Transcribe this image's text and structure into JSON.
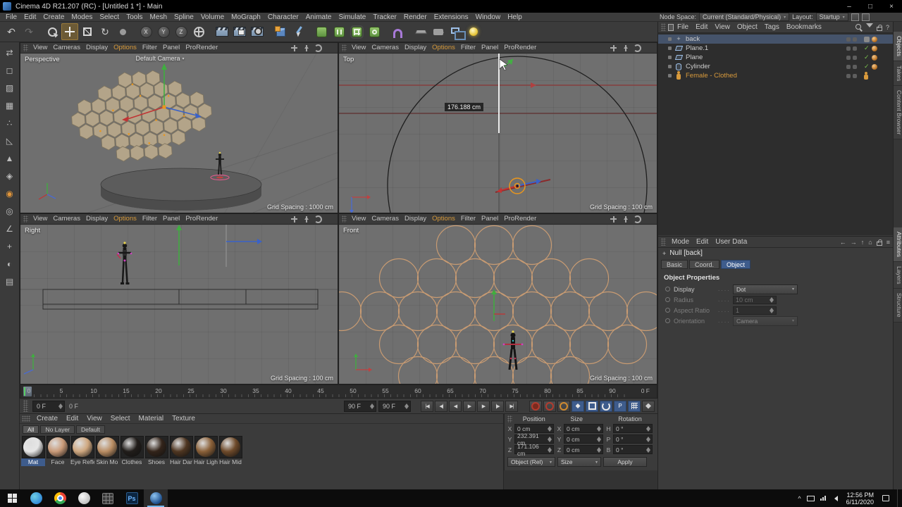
{
  "window": {
    "title": "Cinema 4D R21.207 (RC) - [Untitled 1 *] - Main",
    "controls": [
      "minimize",
      "maximize",
      "close"
    ]
  },
  "menubar": {
    "items": [
      "File",
      "Edit",
      "Create",
      "Modes",
      "Select",
      "Tools",
      "Mesh",
      "Spline",
      "Volume",
      "MoGraph",
      "Character",
      "Animate",
      "Simulate",
      "Tracker",
      "Render",
      "Extensions",
      "Window",
      "Help"
    ]
  },
  "nodespace": {
    "label": "Node Space:",
    "value": "Current (Standard/Physical)",
    "layout_label": "Layout:",
    "layout_value": "Startup"
  },
  "toolbar": {
    "icons": [
      "undo",
      "redo",
      "live-selection",
      "move",
      "scale",
      "rotate",
      "last-tool",
      "axis-x",
      "axis-y",
      "axis-z",
      "coordinate-system",
      "render-view",
      "render-picture-viewer",
      "render-settings",
      "add-cube",
      "spline-pen",
      "subdivision-surface",
      "array-generator",
      "mograph-cloner",
      "volume-builder",
      "bend-deformer",
      "floor",
      "camera",
      "display",
      "light"
    ],
    "active_tool": "move",
    "axis_labels": [
      "X",
      "Y",
      "Z"
    ]
  },
  "sidebar": {
    "icons": [
      "make-editable",
      "model-mode",
      "texture-mode",
      "workplane-mode",
      "points-mode",
      "edges-mode",
      "polygons-mode",
      "tweak-mode",
      "enable-snap",
      "snap-modes",
      "quantize",
      "modeling-axis",
      "solo-mode",
      "layer-color"
    ]
  },
  "viewport_menu": {
    "items": [
      "View",
      "Cameras",
      "Display",
      "Options",
      "Filter",
      "Panel",
      "ProRender"
    ],
    "highlighted": "Options"
  },
  "viewport_controls": [
    "pan",
    "dolly",
    "orbit",
    "maximize"
  ],
  "viewports": {
    "perspective": {
      "name": "Perspective",
      "camera_label": "Default Camera",
      "grid_label": "Grid Spacing : 1000 cm"
    },
    "top": {
      "name": "Top",
      "measurement": "176.188 cm",
      "grid_label": "Grid Spacing : 100 cm"
    },
    "right": {
      "name": "Right",
      "grid_label": "Grid Spacing : 100 cm"
    },
    "front": {
      "name": "Front",
      "grid_label": "Grid Spacing : 100 cm"
    }
  },
  "timeline": {
    "ticks": [
      "0",
      "5",
      "10",
      "15",
      "20",
      "25",
      "30",
      "35",
      "40",
      "45",
      "50",
      "55",
      "60",
      "65",
      "70",
      "75",
      "80",
      "85",
      "90"
    ],
    "right_label": "0 F",
    "start_field": "0 F",
    "start_label": "0 F",
    "end_field": "90 F",
    "end_field_2": "90 F"
  },
  "transport": {
    "playback": [
      "go-to-start",
      "previous-key",
      "previous-frame",
      "play-forward",
      "next-frame",
      "next-key",
      "go-to-end"
    ],
    "recording": [
      "record-active-objects",
      "set-keyframe",
      "autokeying",
      "record-position",
      "record-scale",
      "record-rotation",
      "record-parameter",
      "record-pla",
      "keyframe-selection"
    ]
  },
  "materials": {
    "menu": [
      "Create",
      "Edit",
      "View",
      "Select",
      "Material",
      "Texture"
    ],
    "filters": [
      "All",
      "No Layer",
      "Default"
    ],
    "items": [
      {
        "name": "Mat",
        "color": "#e6e6e6",
        "selected": true
      },
      {
        "name": "Face",
        "color": "#c99a78"
      },
      {
        "name": "Eye Refle",
        "color": "#cfa77f"
      },
      {
        "name": "Skin Mo",
        "color": "#b98d63"
      },
      {
        "name": "Clothes",
        "color": "#211d1a"
      },
      {
        "name": "Shoes",
        "color": "#33241a"
      },
      {
        "name": "Hair Dar",
        "color": "#4f3621"
      },
      {
        "name": "Hair Ligh",
        "color": "#8a6038"
      },
      {
        "name": "Hair Mid",
        "color": "#6e4a2a"
      }
    ]
  },
  "coordinates": {
    "columns": [
      {
        "header": "Position",
        "rows": [
          {
            "l": "X",
            "v": "0 cm"
          },
          {
            "l": "Y",
            "v": "232.391 cm"
          },
          {
            "l": "Z",
            "v": "171.106 cm"
          }
        ]
      },
      {
        "header": "Size",
        "rows": [
          {
            "l": "X",
            "v": "0 cm"
          },
          {
            "l": "Y",
            "v": "0 cm"
          },
          {
            "l": "Z",
            "v": "0 cm"
          }
        ]
      },
      {
        "header": "Rotation",
        "rows": [
          {
            "l": "H",
            "v": "0 °"
          },
          {
            "l": "P",
            "v": "0 °"
          },
          {
            "l": "B",
            "v": "0 °"
          }
        ]
      }
    ],
    "object_dropdown": "Object (Rel)",
    "size_dropdown": "Size",
    "apply": "Apply"
  },
  "object_manager": {
    "menu": [
      "File",
      "Edit",
      "View",
      "Object",
      "Tags",
      "Bookmarks"
    ],
    "items": [
      {
        "name": "back",
        "icon": "null",
        "selected": true,
        "tags": [
          "generic",
          "texture-ball"
        ]
      },
      {
        "name": "Plane.1",
        "icon": "plane",
        "tags": [
          "display-check",
          "texture-ball"
        ]
      },
      {
        "name": "Plane",
        "icon": "plane",
        "tags": [
          "display-check",
          "texture-ball"
        ]
      },
      {
        "name": "Cylinder",
        "icon": "cylinder",
        "tags": [
          "display-check",
          "texture-ball"
        ]
      },
      {
        "name": "Female - Clothed",
        "icon": "figure",
        "color": "#d89a3c",
        "tags": [
          "character"
        ]
      }
    ]
  },
  "attributes": {
    "menu": [
      "Mode",
      "Edit",
      "User Data"
    ],
    "title": "Null [back]",
    "tabs": [
      {
        "label": "Basic",
        "active": false
      },
      {
        "label": "Coord.",
        "active": false
      },
      {
        "label": "Object",
        "active": true
      }
    ],
    "section": "Object Properties",
    "rows": [
      {
        "label": "Display",
        "value": "Dot",
        "control": "dropdown",
        "enabled": true
      },
      {
        "label": "Radius",
        "value": "10 cm",
        "control": "field",
        "enabled": false
      },
      {
        "label": "Aspect Ratio",
        "value": "1",
        "control": "field",
        "enabled": false
      },
      {
        "label": "Orientation",
        "value": "Camera",
        "control": "dropdown",
        "enabled": false
      }
    ]
  },
  "side_tabs": {
    "top": [
      {
        "label": "Objects",
        "active": true
      },
      {
        "label": "Takes",
        "active": false
      },
      {
        "label": "Content Browser",
        "active": false
      }
    ],
    "bottom": [
      {
        "label": "Attributes",
        "active": true
      },
      {
        "label": "Layers",
        "active": false
      },
      {
        "label": "Structure",
        "active": false
      }
    ]
  },
  "taskbar": {
    "apps": [
      {
        "name": "edge"
      },
      {
        "name": "chrome"
      },
      {
        "name": "app-circle"
      },
      {
        "name": "app-grid"
      },
      {
        "name": "photoshop",
        "label": "Ps"
      },
      {
        "name": "cinema4d",
        "active": true
      }
    ],
    "tray": [
      "hidden-icons",
      "display",
      "network",
      "volume"
    ],
    "time": "12:56 PM",
    "date": "6/11/2020"
  }
}
